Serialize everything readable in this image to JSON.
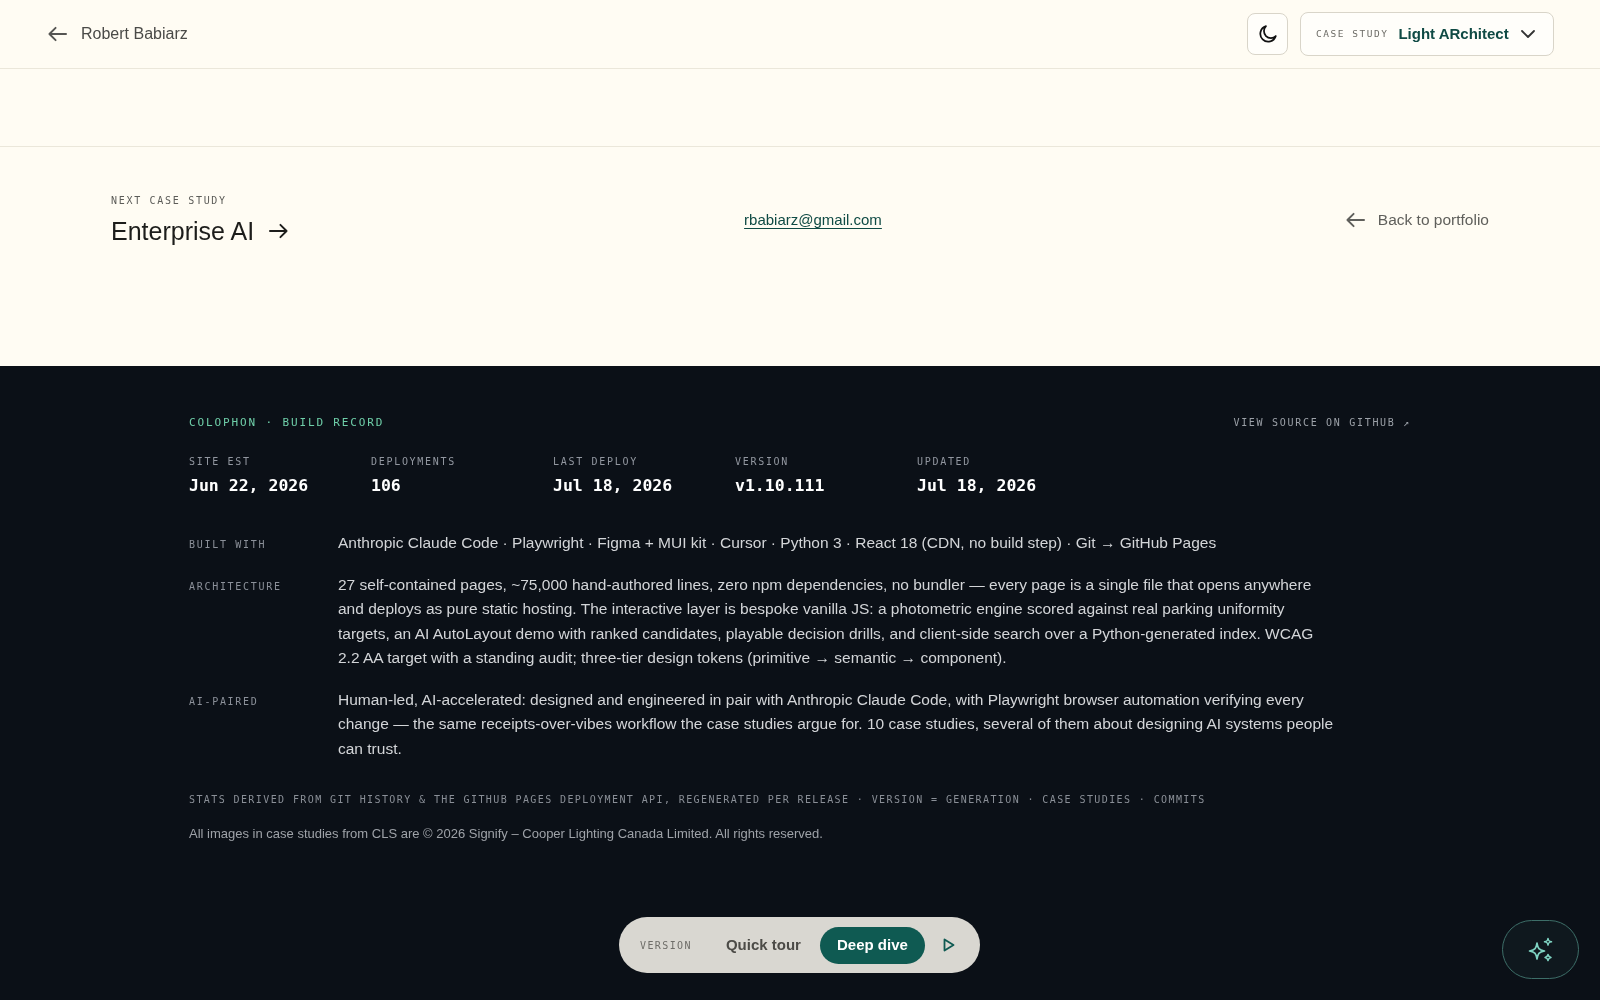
{
  "header": {
    "back_link": "Robert Babiarz",
    "case_study_select": {
      "label": "CASE STUDY",
      "value": "Light ARchitect"
    }
  },
  "next_case_study": {
    "label": "NEXT CASE STUDY",
    "title": "Enterprise AI"
  },
  "contact_email": "rbabiarz@gmail.com",
  "back_to_portfolio": "Back to portfolio",
  "colophon": {
    "title": "COLOPHON · BUILD RECORD",
    "source_link": "VIEW SOURCE ON GITHUB ↗",
    "stats": [
      {
        "label": "SITE EST",
        "value": "Jun 22, 2026"
      },
      {
        "label": "DEPLOYMENTS",
        "value": "106"
      },
      {
        "label": "LAST DEPLOY",
        "value": "Jul 18, 2026"
      },
      {
        "label": "VERSION",
        "value": "v1.10.111"
      },
      {
        "label": "UPDATED",
        "value": "Jul 18, 2026"
      }
    ],
    "details": [
      {
        "label": "BUILT WITH",
        "text": "Anthropic Claude Code · Playwright · Figma + MUI kit · Cursor · Python 3 · React 18 (CDN, no build step) · Git → GitHub Pages"
      },
      {
        "label": "ARCHITECTURE",
        "text": "27 self-contained pages, ~75,000 hand-authored lines, zero npm dependencies, no bundler — every page is a single file that opens anywhere and deploys as pure static hosting. The interactive layer is bespoke vanilla JS: a photometric engine scored against real parking uniformity targets, an AI AutoLayout demo with ranked candidates, playable decision drills, and client-side search over a Python-generated index. WCAG 2.2 AA target with a standing audit; three-tier design tokens (primitive → semantic → component)."
      },
      {
        "label": "AI-PAIRED",
        "text": "Human-led, AI-accelerated: designed and engineered in pair with Anthropic Claude Code, with Playwright browser automation verifying every change — the same receipts-over-vibes workflow the case studies argue for. 10 case studies, several of them about designing AI systems people can trust."
      }
    ],
    "footnote": "STATS DERIVED FROM GIT HISTORY & THE GITHUB PAGES DEPLOYMENT API, REGENERATED PER RELEASE · VERSION = GENERATION · CASE STUDIES · COMMITS",
    "copyright": "All images in case studies from CLS are © 2026 Signify – Cooper Lighting Canada Limited. All rights reserved."
  },
  "version_switch": {
    "label": "VERSION",
    "options": [
      {
        "label": "Quick tour",
        "selected": false
      },
      {
        "label": "Deep dive",
        "selected": true
      }
    ]
  }
}
